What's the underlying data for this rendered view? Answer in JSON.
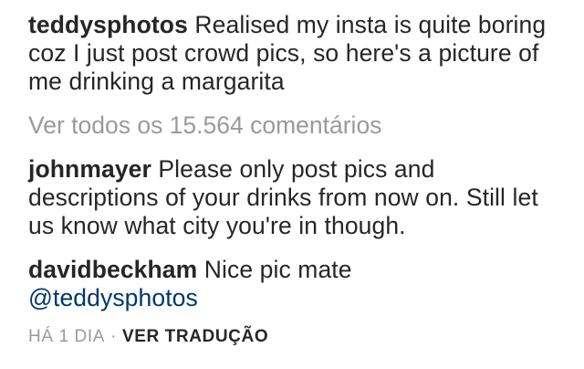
{
  "caption": {
    "username": "teddysphotos",
    "text": "Realised my insta is quite boring coz I just post crowd pics, so here's a picture of me drinking a margarita"
  },
  "view_all_comments": "Ver todos os 15.564 comentários",
  "comments": [
    {
      "username": "johnmayer",
      "text": "Please only post pics and descriptions of your drinks from now on. Still let us know what city you're in though."
    },
    {
      "username": "davidbeckham",
      "text": "Nice pic mate",
      "mention": "@teddysphotos"
    }
  ],
  "meta": {
    "timestamp": "HÁ 1 DIA",
    "separator": "·",
    "translate_label": "VER TRADUÇÃO"
  },
  "colors": {
    "text": "#262626",
    "muted": "#9a9a9a",
    "mention": "#00376b"
  }
}
